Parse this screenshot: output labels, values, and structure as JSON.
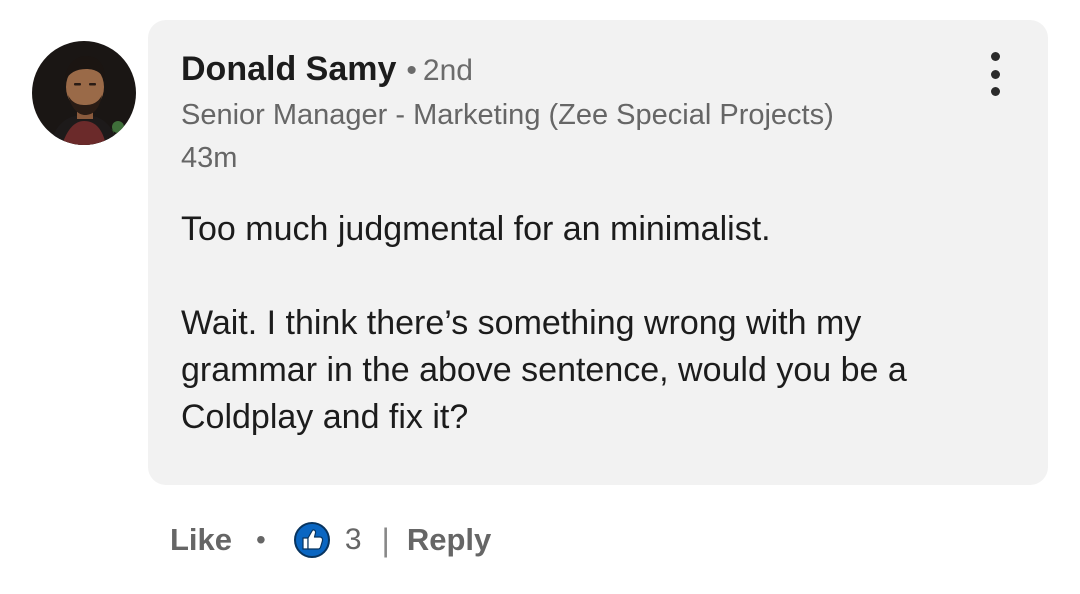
{
  "comment": {
    "author": {
      "name": "Donald Samy",
      "separator": "•",
      "degree": "2nd",
      "headline": "Senior Manager - Marketing (Zee Special Projects)",
      "avatar_icon": "profile-photo-icon"
    },
    "time": "43m",
    "text": {
      "paragraph_1": "Too much judgmental for an minimalist.",
      "paragraph_2": "Wait. I think there’s something wrong with my grammar in the above sentence, would you be a Coldplay and fix it?"
    },
    "more_icon": "vertical-ellipsis-icon"
  },
  "actions": {
    "like_label": "Like",
    "separator": "•",
    "reaction_icon": "thumbs-up-icon",
    "reaction_count": "3",
    "divider": "|",
    "reply_label": "Reply"
  },
  "colors": {
    "bubble_bg": "#f2f2f2",
    "like_blue": "#0a66c2",
    "text_primary": "#1c1c1c",
    "text_secondary": "#666666"
  }
}
